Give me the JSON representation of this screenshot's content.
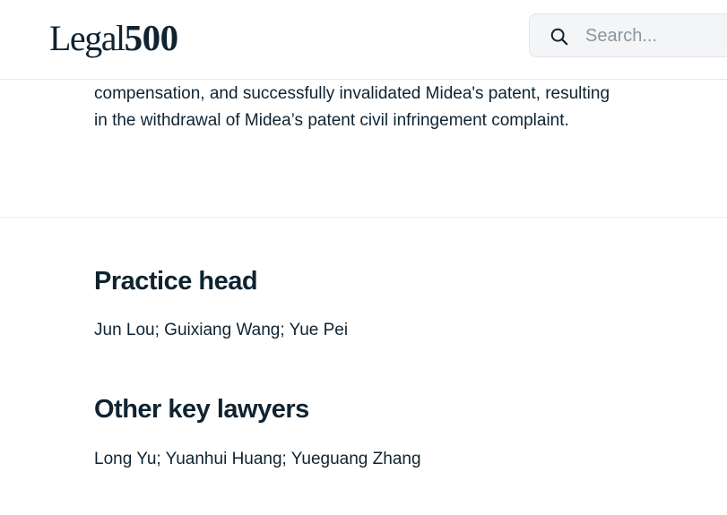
{
  "header": {
    "logo": {
      "word": "Legal",
      "number": "500"
    },
    "search": {
      "placeholder": "Search...",
      "icon": "search-icon"
    }
  },
  "intro": {
    "text": "compensation, and successfully invalidated Midea's patent, resulting in the withdrawal of Midea’s patent civil infringement complaint."
  },
  "sections": [
    {
      "heading": "Practice head",
      "text": "Jun Lou; Guixiang Wang; Yue Pei"
    },
    {
      "heading": "Other key lawyers",
      "text": "Long Yu; Yuanhui Huang; Yueguang Zhang"
    }
  ],
  "colors": {
    "text": "#0f2331",
    "placeholder": "#8a96a0",
    "search_bg": "#f3f5f7",
    "divider": "#e9edf0"
  }
}
